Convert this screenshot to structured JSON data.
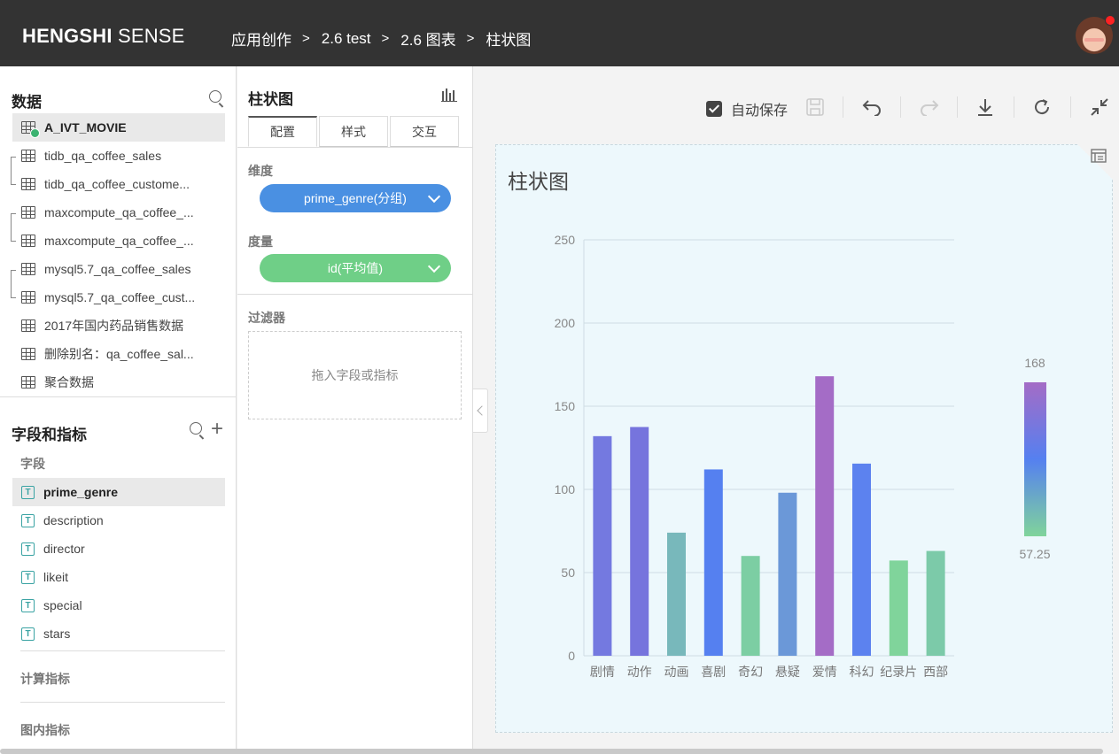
{
  "topbar": {
    "brand_bold": "HENGSHI",
    "brand_light": "SENSE",
    "breadcrumb": [
      "应用创作",
      "2.6 test",
      "2.6 图表",
      "柱状图"
    ],
    "separator": ">"
  },
  "data_panel": {
    "title": "数据",
    "tables": [
      {
        "name": "A_IVT_MOVIE",
        "selected": true
      },
      {
        "name": "tidb_qa_coffee_sales"
      },
      {
        "name": "tidb_qa_coffee_custome..."
      },
      {
        "name": "maxcompute_qa_coffee_..."
      },
      {
        "name": "maxcompute_qa_coffee_..."
      },
      {
        "name": "mysql5.7_qa_coffee_sales"
      },
      {
        "name": "mysql5.7_qa_coffee_cust..."
      },
      {
        "name": "2017年国内药品销售数据"
      },
      {
        "name": "删除别名：qa_coffee_sal..."
      },
      {
        "name": "聚合数据"
      }
    ]
  },
  "fields_panel": {
    "title": "字段和指标",
    "fields_label": "字段",
    "field_type_glyph": "T",
    "fields": [
      {
        "name": "prime_genre",
        "selected": true
      },
      {
        "name": "description"
      },
      {
        "name": "director"
      },
      {
        "name": "likeit"
      },
      {
        "name": "special"
      },
      {
        "name": "stars"
      }
    ],
    "calc_label": "计算指标",
    "inchart_label": "图内指标"
  },
  "config_panel": {
    "title": "柱状图",
    "tabs": [
      "配置",
      "样式",
      "交互"
    ],
    "active_tab": 0,
    "dimension_label": "维度",
    "dimension_value": "prime_genre(分组)",
    "measure_label": "度量",
    "measure_value": "id(平均值)",
    "filter_label": "过滤器",
    "filter_placeholder": "拖入字段或指标",
    "colors": {
      "dimension": "#4a90e2",
      "measure": "#6fcf87"
    }
  },
  "toolbar": {
    "autosave_label": "自动保存",
    "autosave_checked": true,
    "icons": [
      "save-icon",
      "undo-icon",
      "redo-icon",
      "download-icon",
      "refresh-icon",
      "collapse-icon"
    ]
  },
  "chart_data": {
    "type": "bar",
    "title": "柱状图",
    "categories": [
      "剧情",
      "动作",
      "动画",
      "喜剧",
      "奇幻",
      "悬疑",
      "爱情",
      "科幻",
      "纪录片",
      "西部"
    ],
    "values": [
      132,
      137.5,
      74,
      112,
      60,
      98,
      168,
      115.5,
      57.25,
      63
    ],
    "bar_colors": [
      "#7479e0",
      "#7674dd",
      "#78b8bb",
      "#5580f0",
      "#7ccea3",
      "#6b98d8",
      "#a46cc6",
      "#5c82ef",
      "#80d49b",
      "#7ccaa9"
    ],
    "ylim": [
      0,
      250
    ],
    "yticks": [
      0,
      50,
      100,
      150,
      200,
      250
    ],
    "grid": true,
    "legend": {
      "type": "continuous",
      "max_label": "168",
      "min_label": "57.25",
      "gradient": [
        "#a46cc6",
        "#5580f0",
        "#80d49b"
      ],
      "placement": "right"
    }
  }
}
